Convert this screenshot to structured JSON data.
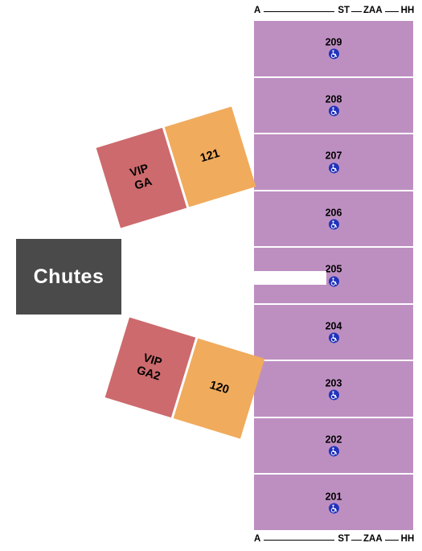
{
  "venue_map": {
    "background_color": "#ffffff",
    "scale_labels": {
      "start": "A",
      "mid_left": "S",
      "mid_right": "T",
      "z": "Z",
      "aa": "AA",
      "end": "HH"
    },
    "chutes": {
      "label": "Chutes",
      "color": "#4a4a4a",
      "text_color": "#ffffff"
    },
    "ga_groups": [
      {
        "vip_label": "VIP\nGA",
        "vip_line1": "VIP",
        "vip_line2": "GA",
        "vip_color": "#cd6a6d",
        "section_label": "121",
        "section_color": "#f0ab5c",
        "rotation": "-17deg"
      },
      {
        "vip_label": "VIP\nGA2",
        "vip_line1": "VIP",
        "vip_line2": "GA2",
        "vip_color": "#cd6a6d",
        "section_label": "120",
        "section_color": "#f0ab5c",
        "rotation": "17deg"
      }
    ],
    "section_color": "#bd8fc1",
    "divider_color": "#ffffff",
    "accessible_icon_color": "#2233bb",
    "sections": [
      {
        "number": "209",
        "accessible": true,
        "icon": "wheelchair-icon"
      },
      {
        "number": "208",
        "accessible": true,
        "icon": "wheelchair-icon"
      },
      {
        "number": "207",
        "accessible": true,
        "icon": "wheelchair-icon"
      },
      {
        "number": "206",
        "accessible": true,
        "icon": "wheelchair-icon"
      },
      {
        "number": "205",
        "accessible": true,
        "icon": "wheelchair-icon"
      },
      {
        "number": "204",
        "accessible": true,
        "icon": "wheelchair-icon"
      },
      {
        "number": "203",
        "accessible": true,
        "icon": "wheelchair-icon"
      },
      {
        "number": "202",
        "accessible": true,
        "icon": "wheelchair-icon"
      },
      {
        "number": "201",
        "accessible": true,
        "icon": "wheelchair-icon"
      }
    ]
  }
}
